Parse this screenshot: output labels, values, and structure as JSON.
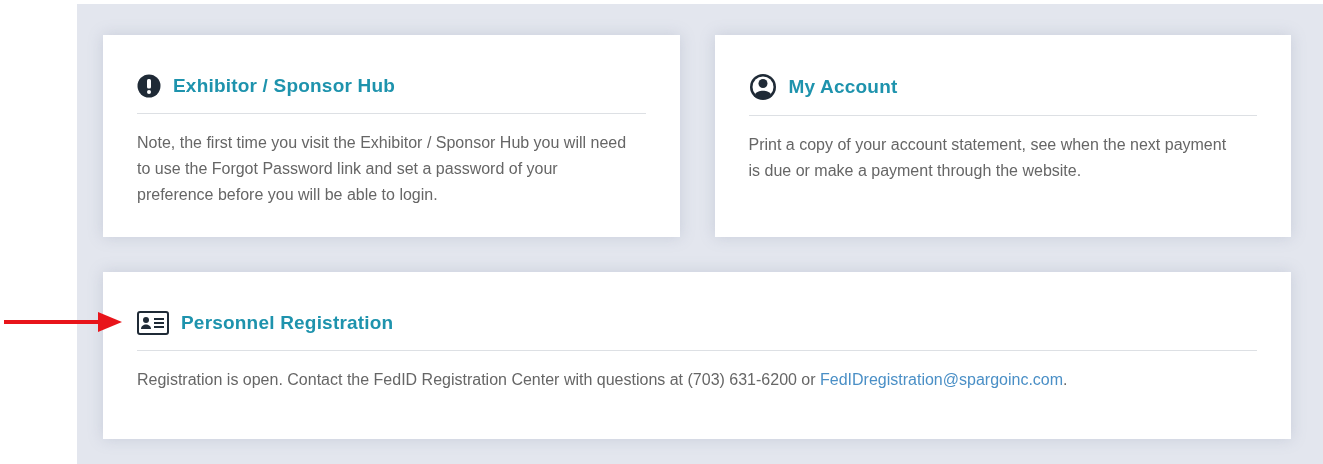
{
  "cards": [
    {
      "kind": "alert",
      "title": "Exhibitor / Sponsor Hub",
      "body": "Note, the first time you visit the Exhibitor / Sponsor Hub you will need to use the Forgot Password link and set a password of your preference before you will be able to login."
    },
    {
      "kind": "user",
      "title": "My Account",
      "body": "Print a copy of your account statement, see when the next payment is due or make a payment through the website."
    },
    {
      "kind": "id-card",
      "title": "Personnel Registration",
      "body": "Registration is open. Contact the FedID Registration Center with questions at (703) 631-6200 or ",
      "link": "FedIDregistration@spargoinc.com",
      "body_end": "."
    }
  ]
}
